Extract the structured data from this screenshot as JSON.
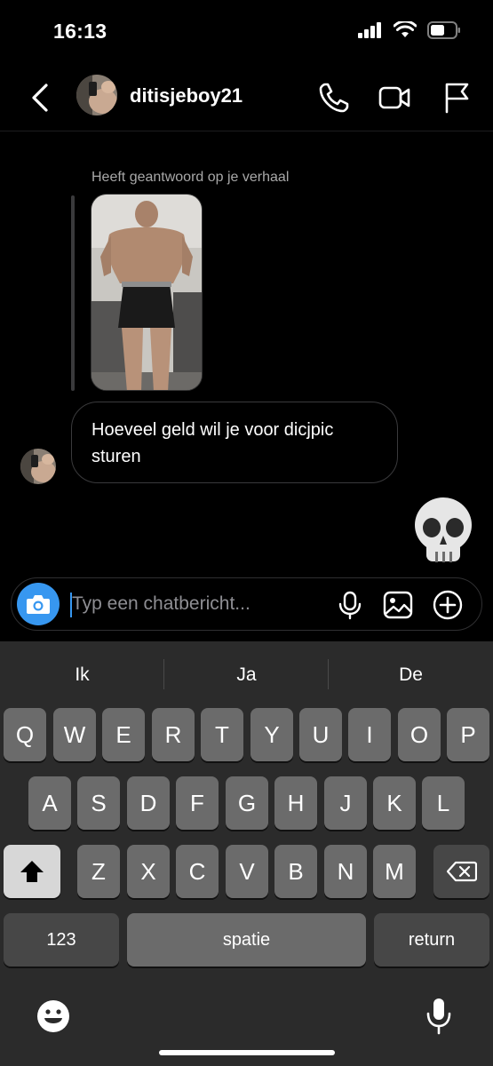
{
  "status": {
    "time": "16:13"
  },
  "header": {
    "username": "ditisjeboy21"
  },
  "story_reply": {
    "label": "Heeft geantwoord op je verhaal"
  },
  "message": {
    "text": "Hoeveel geld wil je voor dicjpic sturen"
  },
  "reaction": {
    "emoji": "💀"
  },
  "composer": {
    "placeholder": "Typ een chatbericht..."
  },
  "keyboard": {
    "suggestions": [
      "Ik",
      "Ja",
      "De"
    ],
    "row1": [
      "Q",
      "W",
      "E",
      "R",
      "T",
      "Y",
      "U",
      "I",
      "O",
      "P"
    ],
    "row2": [
      "A",
      "S",
      "D",
      "F",
      "G",
      "H",
      "J",
      "K",
      "L"
    ],
    "row3": [
      "Z",
      "X",
      "C",
      "V",
      "B",
      "N",
      "M"
    ],
    "numbers_label": "123",
    "space_label": "spatie",
    "return_label": "return"
  },
  "colors": {
    "accent": "#3797f0",
    "background": "#000000",
    "keyboard": "#2b2b2b"
  }
}
